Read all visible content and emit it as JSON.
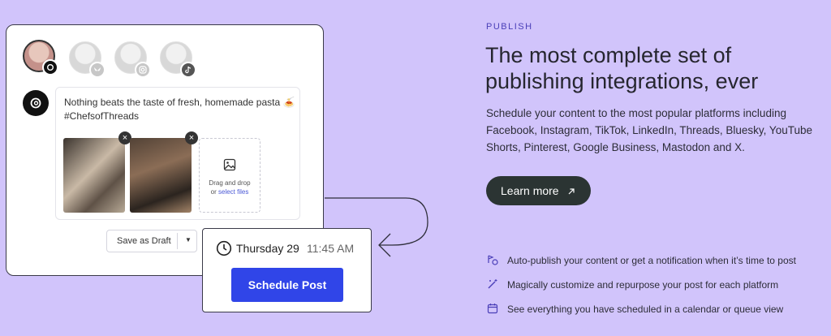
{
  "post": {
    "text": "Nothing beats the taste of fresh, homemade pasta 🍝\n#ChefsofThreads",
    "dropzone_text": "Drag and drop",
    "dropzone_or": "or",
    "dropzone_link": "select files",
    "remove_symbol": "×"
  },
  "draft": {
    "label": "Save as Draft",
    "caret": "▼"
  },
  "schedule": {
    "day": "Thursday 29",
    "time": "11:45 AM",
    "button": "Schedule Post"
  },
  "marketing": {
    "eyebrow": "PUBLISH",
    "headline": "The most complete set of publishing integrations, ever",
    "description": "Schedule your content to the most popular platforms including Facebook, Instagram, TikTok, LinkedIn, Threads, Bluesky, YouTube Shorts, Pinterest, Google Business, Mastodon and X.",
    "cta": "Learn more",
    "features": [
      "Auto-publish your content or get a notification when it’s time to post",
      "Magically customize and repurpose your post for each platform",
      "See everything you have scheduled in a calendar or queue view"
    ]
  },
  "colors": {
    "background": "#d1c4fb",
    "primary_button": "#3045e8",
    "cta_button": "#2b3433",
    "eyebrow": "#4a3fb8"
  },
  "icons": [
    "threads-icon",
    "bluesky-icon",
    "instagram-icon",
    "tiktok-icon",
    "image-icon",
    "clock-icon",
    "arrow-up-right-icon",
    "auto-publish-icon",
    "magic-wand-icon",
    "calendar-icon"
  ]
}
